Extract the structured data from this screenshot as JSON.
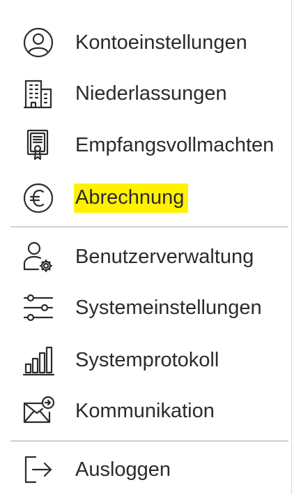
{
  "menu": {
    "items": [
      {
        "label": "Kontoeinstellungen",
        "icon": "user-circle-icon"
      },
      {
        "label": "Niederlassungen",
        "icon": "building-icon"
      },
      {
        "label": "Empfangsvollmachten",
        "icon": "certificate-icon"
      },
      {
        "label": "Abrechnung",
        "icon": "euro-icon",
        "highlighted": true
      },
      {
        "label": "Benutzerverwaltung",
        "icon": "user-gear-icon"
      },
      {
        "label": "Systemeinstellungen",
        "icon": "sliders-icon"
      },
      {
        "label": "Systemprotokoll",
        "icon": "bar-chart-icon"
      },
      {
        "label": "Kommunikation",
        "icon": "envelope-icon"
      },
      {
        "label": "Ausloggen",
        "icon": "logout-icon"
      }
    ]
  },
  "colors": {
    "text": "#2b2b2b",
    "highlight": "#fff200",
    "divider": "#cfcfcf"
  }
}
